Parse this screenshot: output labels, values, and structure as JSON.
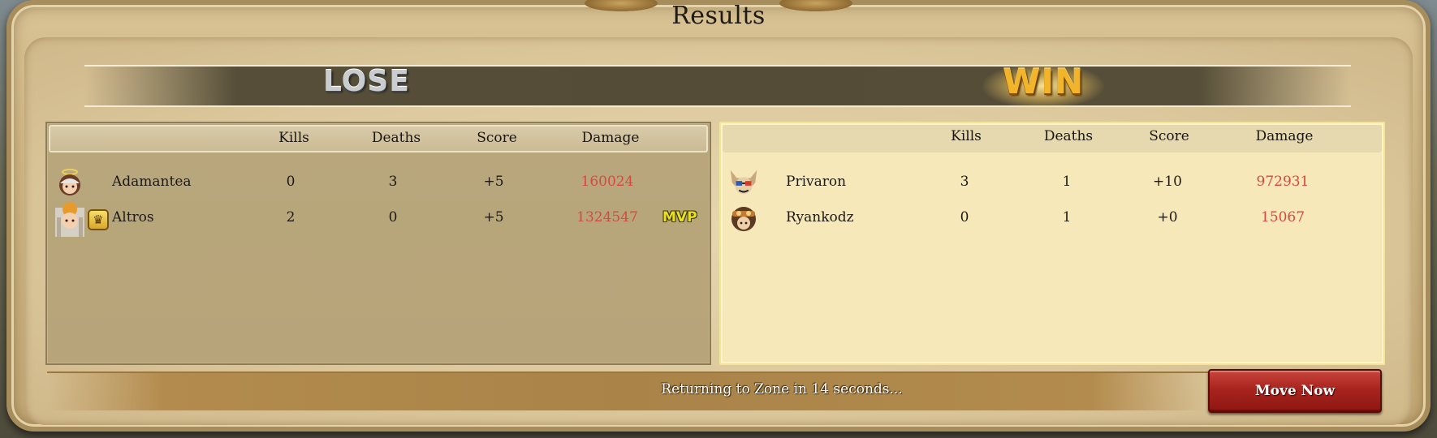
{
  "window": {
    "title": "Results"
  },
  "teams": {
    "left": {
      "result": "LOSE",
      "columns": [
        "Kills",
        "Deaths",
        "Score",
        "Damage"
      ],
      "players": [
        {
          "name": "Adamantea",
          "kills": "0",
          "deaths": "3",
          "score": "+5",
          "damage": "160024",
          "mvp": ""
        },
        {
          "name": "Altros",
          "kills": "2",
          "deaths": "0",
          "score": "+5",
          "damage": "1324547",
          "mvp": "MVP"
        }
      ]
    },
    "right": {
      "result": "WIN",
      "columns": [
        "Kills",
        "Deaths",
        "Score",
        "Damage"
      ],
      "players": [
        {
          "name": "Privaron",
          "kills": "3",
          "deaths": "1",
          "score": "+10",
          "damage": "972931"
        },
        {
          "name": "Ryankodz",
          "kills": "0",
          "deaths": "1",
          "score": "+0",
          "damage": "15067"
        }
      ]
    }
  },
  "footer": {
    "countdown_text": "Returning to Zone in 14 seconds...",
    "move_button_label": "Move Now"
  },
  "colors": {
    "damage": "#d8483f",
    "mvp": "#e8e020",
    "win": "#f2b52a",
    "lose": "#c9cdd0",
    "move_button": "#a8241e"
  },
  "icons": {
    "crown": "crown-icon"
  }
}
